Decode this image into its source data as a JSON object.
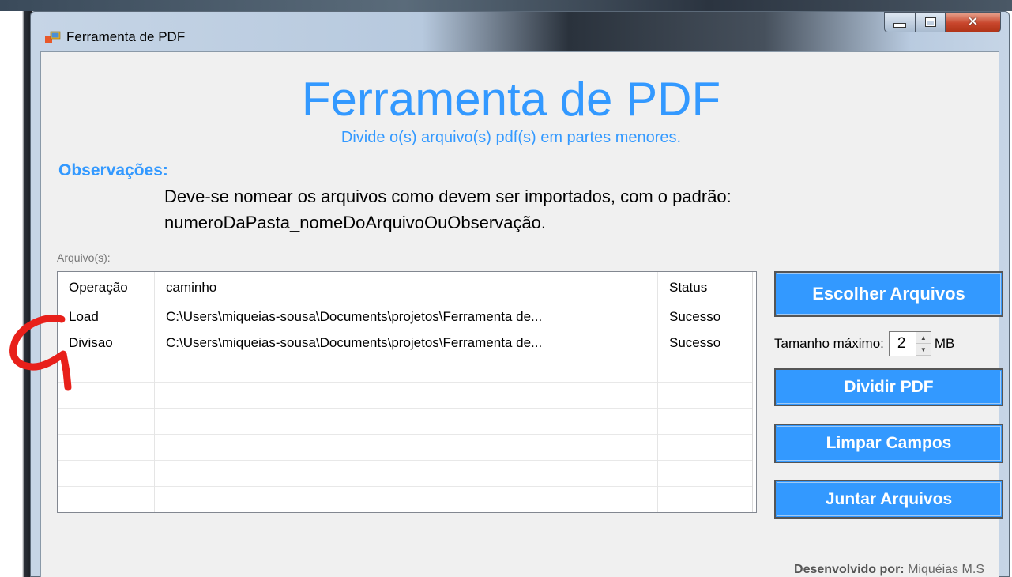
{
  "window": {
    "title": "Ferramenta de PDF"
  },
  "header": {
    "title": "Ferramenta de PDF",
    "subtitle": "Divide o(s) arquivo(s) pdf(s) em partes menores."
  },
  "notes": {
    "label": "Observações:",
    "line1": "Deve-se nomear os arquivos como devem ser importados, com o padrão:",
    "line2": "numeroDaPasta_nomeDoArquivoOuObservação."
  },
  "files": {
    "label": "Arquivo(s):",
    "columns": [
      "Operação",
      "caminho",
      "Status"
    ],
    "rows": [
      {
        "operacao": "Load",
        "caminho": "C:\\Users\\miqueias-sousa\\Documents\\projetos\\Ferramenta de...",
        "status": "Sucesso"
      },
      {
        "operacao": "Divisao",
        "caminho": "C:\\Users\\miqueias-sousa\\Documents\\projetos\\Ferramenta de...",
        "status": "Sucesso"
      }
    ]
  },
  "actions": {
    "choose_label": "Escolher Arquivos",
    "max_size_label": "Tamanho máximo:",
    "max_size_value": "2",
    "max_size_unit": "MB",
    "split_label": "Dividir PDF",
    "clear_label": "Limpar Campos",
    "join_label": "Juntar Arquivos"
  },
  "footer": {
    "credit_prefix": "Desenvolvido por:",
    "credit_name": "Miquéias M.S"
  },
  "colors": {
    "accent": "#3399ff",
    "annotation": "#e8201a"
  }
}
